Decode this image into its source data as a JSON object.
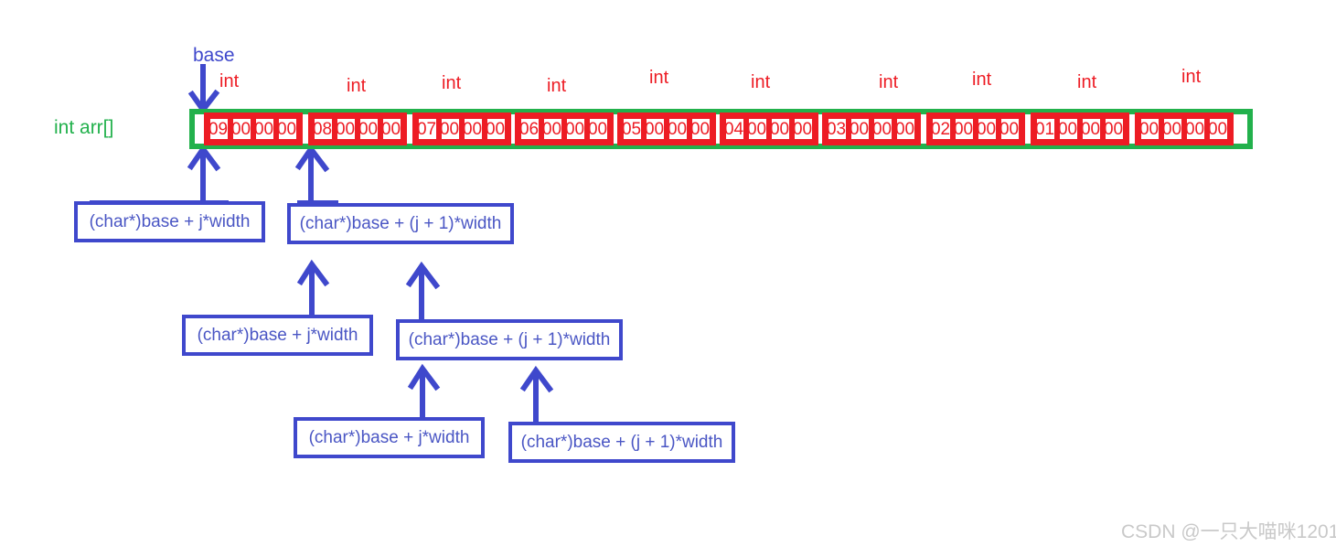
{
  "diagram": {
    "title_labels": {
      "base": "base",
      "array_decl": "int arr[]",
      "type_label": "int"
    },
    "array": {
      "element_type": "int",
      "element_count": 10,
      "bytes_per_element": 4,
      "groups": [
        {
          "value": 9,
          "bytes": [
            "09",
            "00",
            "00",
            "00"
          ]
        },
        {
          "value": 8,
          "bytes": [
            "08",
            "00",
            "00",
            "00"
          ]
        },
        {
          "value": 7,
          "bytes": [
            "07",
            "00",
            "00",
            "00"
          ]
        },
        {
          "value": 6,
          "bytes": [
            "06",
            "00",
            "00",
            "00"
          ]
        },
        {
          "value": 5,
          "bytes": [
            "05",
            "00",
            "00",
            "00"
          ]
        },
        {
          "value": 4,
          "bytes": [
            "04",
            "00",
            "00",
            "00"
          ]
        },
        {
          "value": 3,
          "bytes": [
            "03",
            "00",
            "00",
            "00"
          ]
        },
        {
          "value": 2,
          "bytes": [
            "02",
            "00",
            "00",
            "00"
          ]
        },
        {
          "value": 1,
          "bytes": [
            "01",
            "00",
            "00",
            "00"
          ]
        },
        {
          "value": 0,
          "bytes": [
            "00",
            "00",
            "00",
            "00"
          ]
        }
      ]
    },
    "notes": [
      {
        "text": "(char*)base + j*width",
        "row": 1
      },
      {
        "text": "(char*)base + (j + 1)*width",
        "row": 1
      },
      {
        "text": "(char*)base + j*width",
        "row": 2
      },
      {
        "text": "(char*)base + (j + 1)*width",
        "row": 2
      },
      {
        "text": "(char*)base + j*width",
        "row": 3
      },
      {
        "text": "(char*)base + (j + 1)*width",
        "row": 3
      }
    ],
    "colors": {
      "array_border": "#22b14c",
      "byte_border": "#ed1c24",
      "annotation": "#3f48cc",
      "declaration": "#22b14c",
      "watermark": "#c9c9c9"
    },
    "watermark": "CSDN @一只大喵咪1201"
  }
}
